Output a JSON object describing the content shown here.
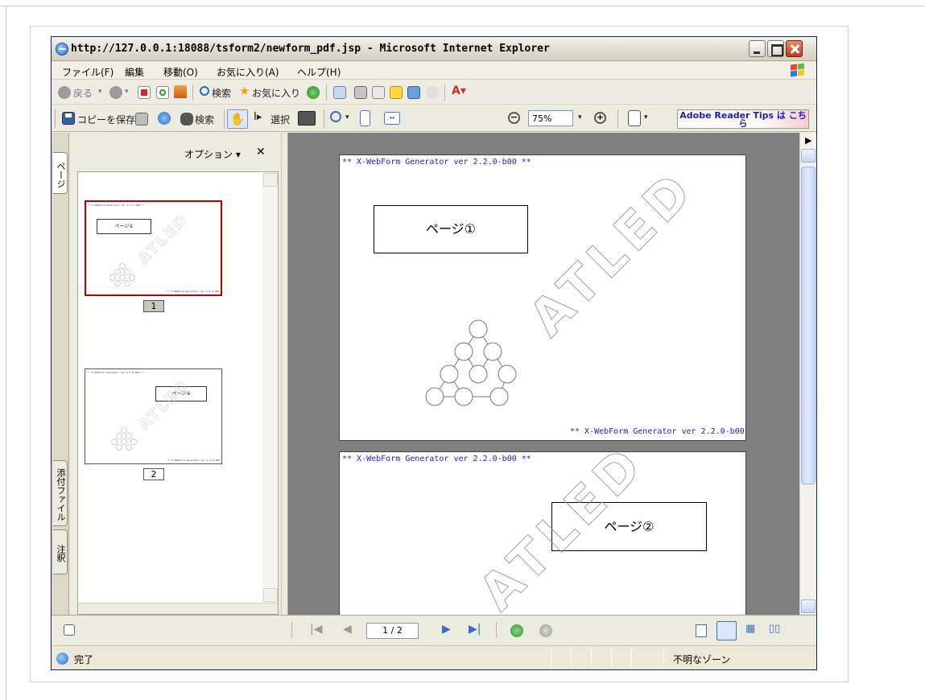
{
  "window": {
    "title": "http://127.0.0.1:18088/tsform2/newform_pdf.jsp - Microsoft Internet Explorer"
  },
  "menu": {
    "items": [
      "ファイル(F)",
      "編集",
      "移動(O)",
      "お気に入り(A)",
      "ヘルプ(H)"
    ]
  },
  "toolbar": {
    "back_label": "戻る",
    "search_label": "検索",
    "favorites_label": "お気に入り"
  },
  "reader_toolbar": {
    "save_copy_label": "コピーを保存",
    "search_label": "検索",
    "select_label": "選択",
    "zoom_value": "75%",
    "tips_label": "Adobe Reader Tips は こちら"
  },
  "side_tabs": {
    "pages": "ページ",
    "attachments": "添付ファイル",
    "comments": "注釈"
  },
  "panel": {
    "options_label": "オプション ▾",
    "close_label": "✕"
  },
  "thumbnails": [
    {
      "number": "1",
      "box_label": "ページ①"
    },
    {
      "number": "2",
      "box_label": "ページ②"
    }
  ],
  "pages": [
    {
      "header": "** X-WebForm Generator ver 2.2.0-b00 **",
      "box_label": "ページ①",
      "footer": "** X-WebForm Generator ver 2.2.0-b00",
      "watermark": "ATLED"
    },
    {
      "header": "** X-WebForm Generator ver 2.2.0-b00 **",
      "box_label": "ページ②",
      "watermark": "ATLED"
    }
  ],
  "navigation": {
    "page_indicator": "1 / 2"
  },
  "status": {
    "text": "完了",
    "zone": "不明なゾーン"
  },
  "icons": [
    "ie-icon",
    "minimize-icon",
    "maximize-icon",
    "close-icon",
    "windows-logo-icon",
    "back-arrow-icon",
    "forward-arrow-icon",
    "stop-icon",
    "refresh-icon",
    "home-icon",
    "search-icon",
    "favorites-star-icon",
    "history-icon",
    "mail-icon",
    "print-icon",
    "edit-icon",
    "save-icon",
    "email-icon",
    "binoculars-icon",
    "hand-tool-icon",
    "select-tool-icon",
    "snapshot-icon",
    "zoom-in-icon",
    "fit-page-icon",
    "fit-width-icon",
    "zoom-out-minus-icon",
    "zoom-plus-icon",
    "pages-icon",
    "first-page-icon",
    "prev-page-icon",
    "next-page-icon",
    "last-page-icon",
    "go-back-icon",
    "go-forward-icon",
    "single-page-icon",
    "continuous-icon",
    "facing-icon",
    "continuous-facing-icon"
  ]
}
